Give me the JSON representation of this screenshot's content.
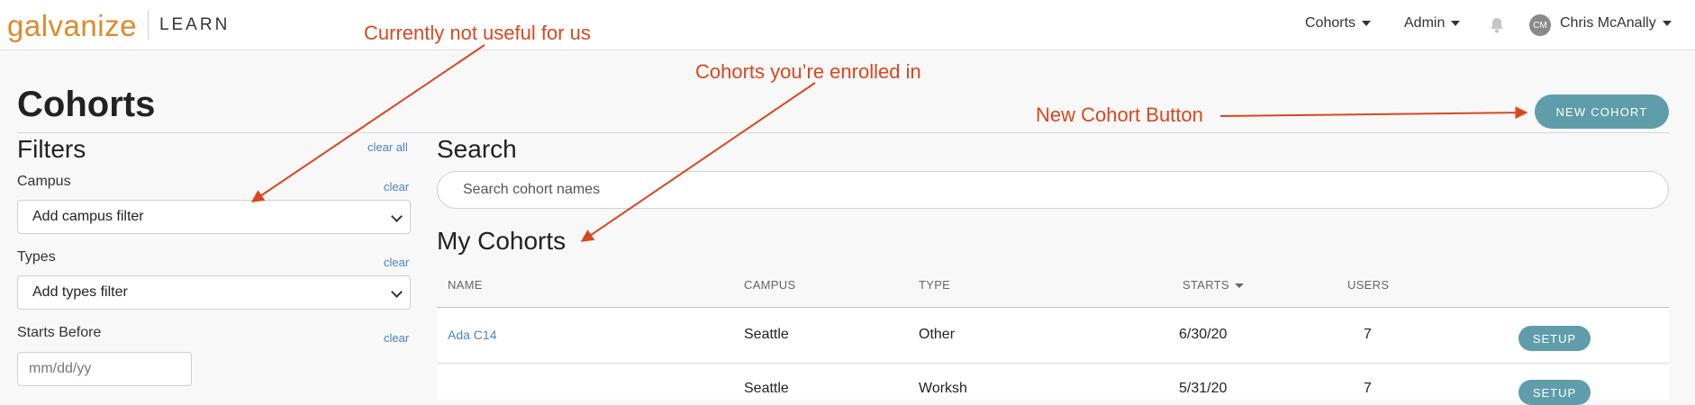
{
  "brand": {
    "logo": "galvanize",
    "product": "LEARN"
  },
  "nav": {
    "cohorts": "Cohorts",
    "admin": "Admin",
    "avatar_initials": "CM",
    "user_name": "Chris McAnally"
  },
  "page": {
    "title": "Cohorts",
    "new_cohort": "NEW COHORT"
  },
  "filters": {
    "title": "Filters",
    "clear_all": "clear all",
    "campus": {
      "label": "Campus",
      "clear": "clear",
      "value": "Add campus filter"
    },
    "types": {
      "label": "Types",
      "clear": "clear",
      "value": "Add types filter"
    },
    "starts_before": {
      "label": "Starts Before",
      "clear": "clear",
      "placeholder": "mm/dd/yy"
    }
  },
  "search": {
    "title": "Search",
    "placeholder": "Search cohort names"
  },
  "my_cohorts": {
    "title": "My Cohorts",
    "columns": {
      "name": "NAME",
      "campus": "CAMPUS",
      "type": "TYPE",
      "starts": "STARTS",
      "users": "USERS"
    },
    "rows": [
      {
        "name": "Ada C14",
        "campus": "Seattle",
        "type": "Other",
        "starts": "6/30/20",
        "users": "7",
        "action": "SETUP"
      },
      {
        "name": "",
        "campus": "Seattle",
        "type": "Worksh",
        "starts": "5/31/20",
        "users": "7",
        "action": "SETUP"
      }
    ]
  },
  "annotations": {
    "not_useful": "Currently not useful for us",
    "enrolled": "Cohorts you’re enrolled in",
    "new_cohort_button": "New Cohort Button"
  },
  "colors": {
    "accent": "#5f9daa",
    "link": "#4a84c4",
    "annotation": "#d9471f",
    "brand": "#e0892a"
  },
  "icons": {
    "bell": "bell-icon",
    "caret": "caret-down-icon",
    "sort": "sort-desc-icon"
  }
}
